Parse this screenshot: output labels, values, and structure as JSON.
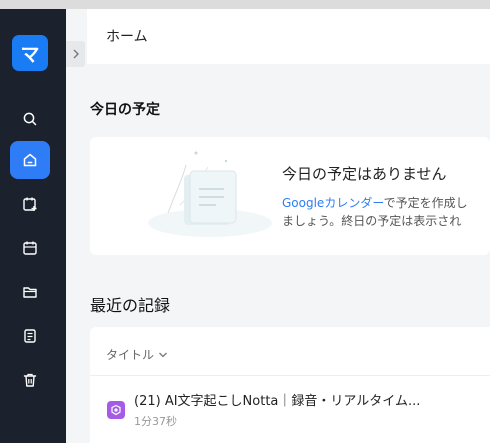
{
  "app": {
    "logo_text": "マ"
  },
  "sidebar": {
    "items": [
      {
        "name": "search",
        "active": false
      },
      {
        "name": "home",
        "active": true
      },
      {
        "name": "calendar-add",
        "active": false
      },
      {
        "name": "calendar",
        "active": false
      },
      {
        "name": "folder",
        "active": false
      },
      {
        "name": "notes",
        "active": false
      },
      {
        "name": "trash",
        "active": false
      }
    ]
  },
  "header": {
    "title": "ホーム"
  },
  "today": {
    "section_title": "今日の予定",
    "empty_title": "今日の予定はありません",
    "desc_link": "Googleカレンダー",
    "desc_line1_rest": "で予定を作成し",
    "desc_line2": "ましょう。終日の予定は表示され"
  },
  "recent": {
    "section_title": "最近の記録",
    "column_header": "タイトル",
    "rows": [
      {
        "title": "(21) AI文字起こしNotta｜録音・リアルタイム...",
        "duration": "1分37秒"
      }
    ]
  },
  "colors": {
    "accent": "#2f7df6",
    "sidebar_bg": "#1b222d",
    "row_icon": "#a55be6"
  }
}
